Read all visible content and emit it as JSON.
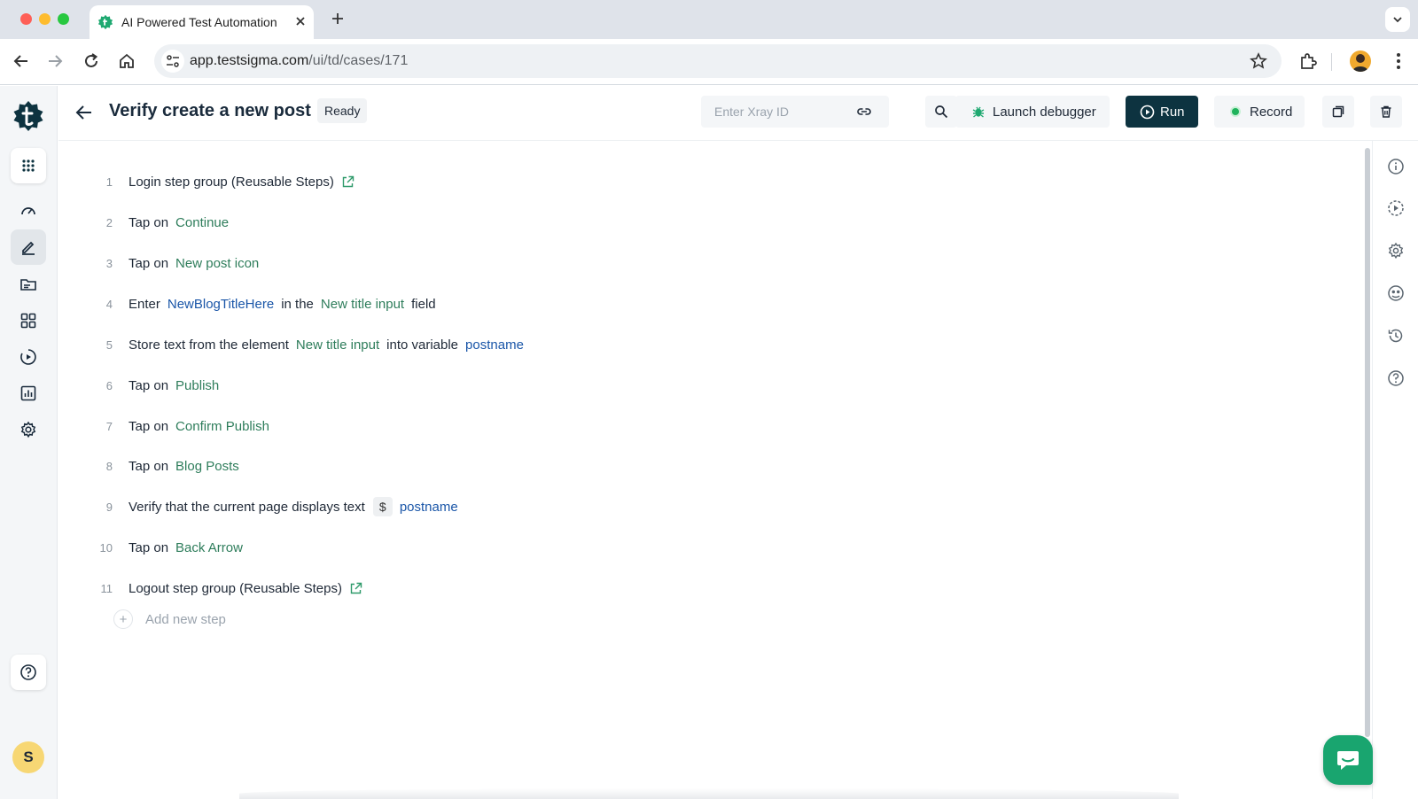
{
  "browser": {
    "tab_title": "AI Powered Test Automation P",
    "url_host": "app.testsigma.com",
    "url_path": "/ui/td/cases/171"
  },
  "header": {
    "title": "Verify create a new post",
    "status": "Ready",
    "xray_placeholder": "Enter Xray ID",
    "launch_debugger_label": "Launch debugger",
    "run_label": "Run",
    "record_label": "Record"
  },
  "user": {
    "avatar_initial": "S"
  },
  "steps": [
    {
      "num": "1",
      "text": "Login step group (Reusable Steps)"
    },
    {
      "num": "2",
      "action": "Tap on",
      "element": "Continue"
    },
    {
      "num": "3",
      "action": "Tap on",
      "element": "New post icon"
    },
    {
      "num": "4",
      "action": "Enter",
      "data": "NewBlogTitleHere",
      "mid": "in the",
      "element": "New title input",
      "suffix": "field"
    },
    {
      "num": "5",
      "action": "Store text from the element",
      "element": "New title input",
      "mid": "into variable",
      "variable": "postname"
    },
    {
      "num": "6",
      "action": "Tap on",
      "element": "Publish"
    },
    {
      "num": "7",
      "action": "Tap on",
      "element": "Confirm Publish"
    },
    {
      "num": "8",
      "action": "Tap on",
      "element": "Blog Posts"
    },
    {
      "num": "9",
      "action": "Verify that the current page displays text",
      "var_symbol": "$",
      "variable": "postname"
    },
    {
      "num": "10",
      "action": "Tap on",
      "element": "Back Arrow"
    },
    {
      "num": "11",
      "text": "Logout step group (Reusable Steps)"
    }
  ],
  "add_step_label": "Add new step",
  "colors": {
    "brand_dark": "#0d3340",
    "element_green": "#2e7d5b",
    "data_blue": "#1a56a8",
    "chat_green": "#19a56f"
  }
}
